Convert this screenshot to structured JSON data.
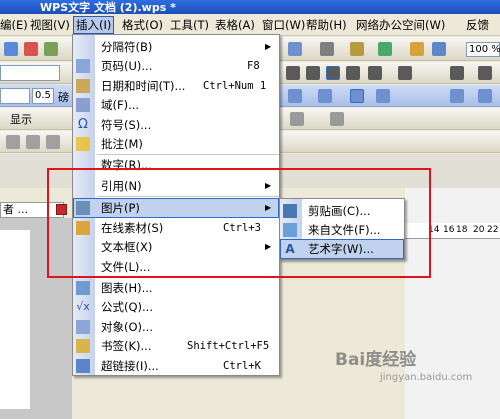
{
  "window": {
    "title": "WPS文字 文档 (2).wps *"
  },
  "menubar": {
    "items": [
      "编(E)",
      "视图(V)",
      "插入(I)",
      "格式(O)",
      "工具(T)",
      "表格(A)",
      "窗口(W)",
      "帮助(H)",
      "网络办公空间(W)",
      "反馈"
    ]
  },
  "toolbar": {
    "zoom": "100 %",
    "font_size": "0.5",
    "font_unit": "磅",
    "display_label": "显示",
    "doc_tab": "者 ..."
  },
  "insert_menu": {
    "items": [
      {
        "label": "分隔符(B)",
        "shortcut": "",
        "submenu": true
      },
      {
        "label": "页码(U)...",
        "shortcut": "F8",
        "submenu": false
      },
      {
        "label": "日期和时间(T)...",
        "shortcut": "Ctrl+Num 1",
        "submenu": false
      },
      {
        "label": "域(F)...",
        "shortcut": "",
        "submenu": false
      },
      {
        "label": "符号(S)...",
        "shortcut": "",
        "submenu": false
      },
      {
        "label": "批注(M)",
        "shortcut": "",
        "submenu": false
      },
      {
        "label": "数字(R)...",
        "shortcut": "",
        "submenu": false
      },
      {
        "label": "引用(N)",
        "shortcut": "",
        "submenu": true
      },
      {
        "label": "图片(P)",
        "shortcut": "",
        "submenu": true
      },
      {
        "label": "在线素材(S)",
        "shortcut": "Ctrl+3",
        "submenu": false
      },
      {
        "label": "文本框(X)",
        "shortcut": "",
        "submenu": true
      },
      {
        "label": "文件(L)...",
        "shortcut": "",
        "submenu": false
      },
      {
        "label": "图表(H)...",
        "shortcut": "",
        "submenu": false
      },
      {
        "label": "公式(Q)...",
        "shortcut": "",
        "submenu": false
      },
      {
        "label": "对象(O)...",
        "shortcut": "",
        "submenu": false
      },
      {
        "label": "书签(K)...",
        "shortcut": "Shift+Ctrl+F5",
        "submenu": false
      },
      {
        "label": "超链接(I)...",
        "shortcut": "Ctrl+K",
        "submenu": false
      }
    ]
  },
  "picture_submenu": {
    "items": [
      {
        "label": "剪贴画(C)..."
      },
      {
        "label": "来自文件(F)..."
      },
      {
        "label": "艺术字(W)..."
      }
    ]
  },
  "ruler": {
    "ticks": [
      "14",
      "16",
      "18",
      "20",
      "22"
    ]
  },
  "watermark": {
    "brand": "Bai度经验",
    "url": "jingyan.baidu.com"
  },
  "colors": {
    "highlight": "#c1d2ee",
    "annotation": "#e0141c",
    "menu_gutter": "#c5d2ed"
  }
}
